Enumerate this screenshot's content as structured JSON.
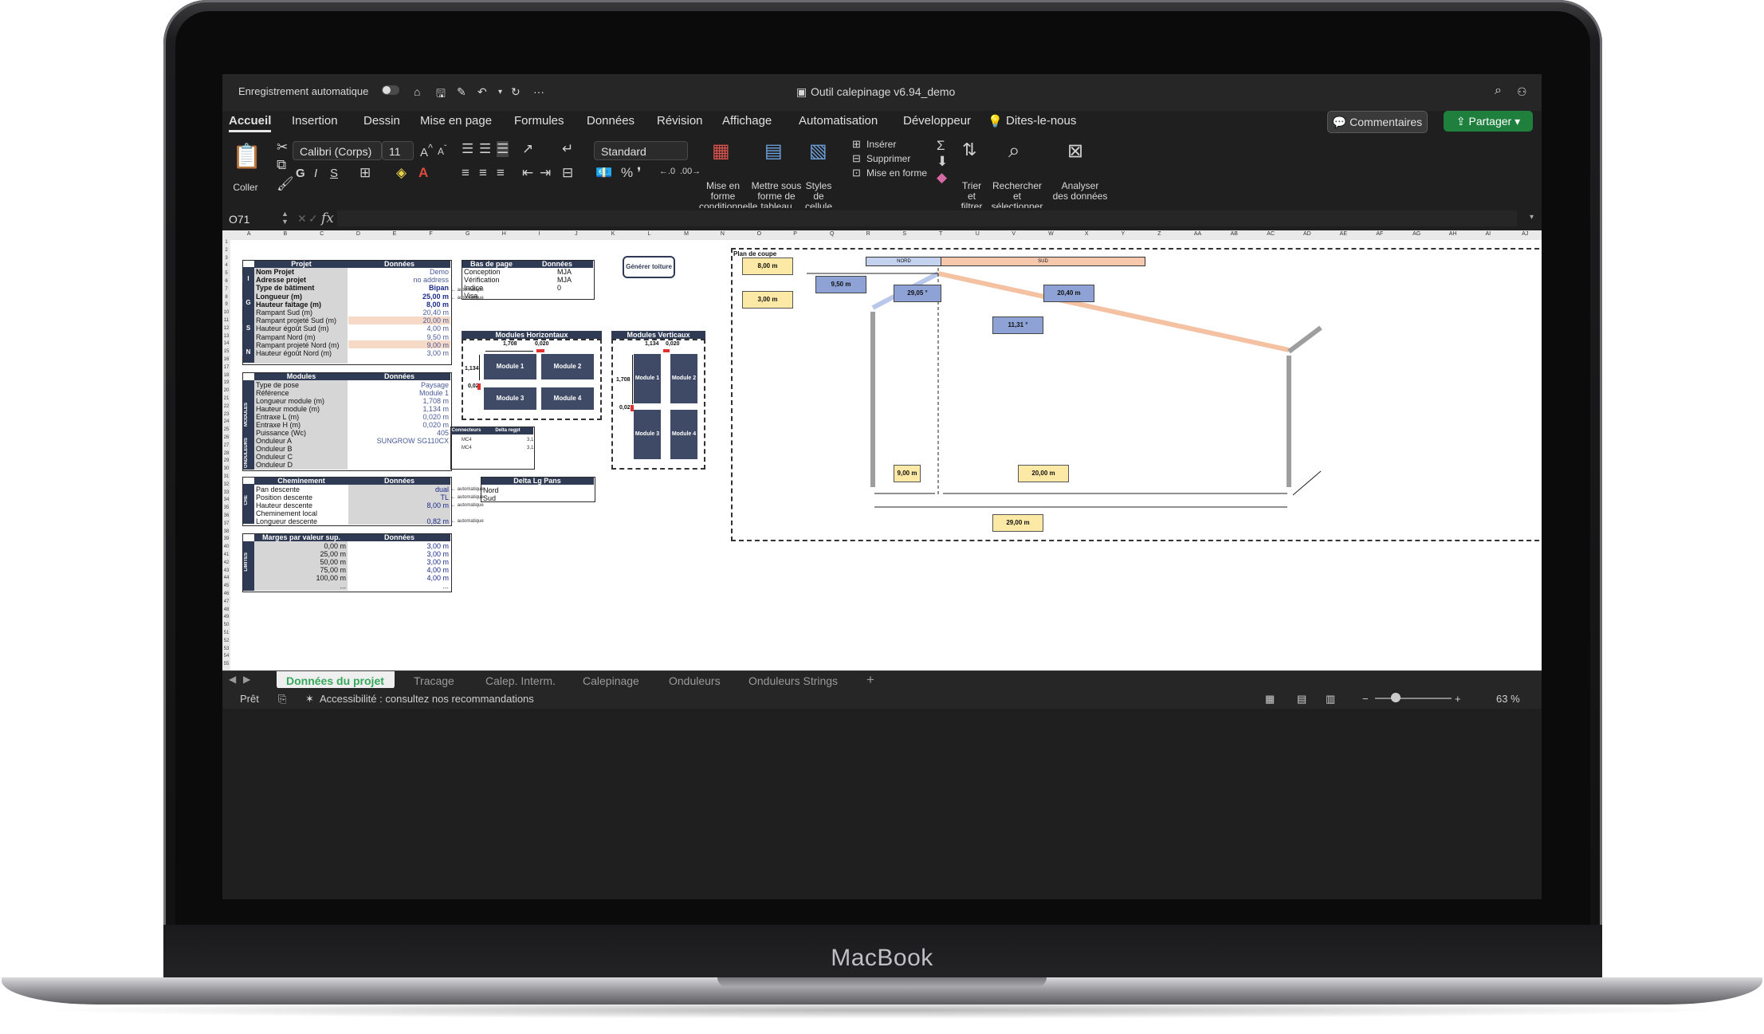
{
  "device": {
    "brand": "MacBook"
  },
  "titlebar": {
    "autosave": "Enregistrement automatique",
    "filename": "Outil calepinage v6.94_demo"
  },
  "menu": {
    "tabs": [
      "Accueil",
      "Insertion",
      "Dessin",
      "Mise en page",
      "Formules",
      "Données",
      "Révision",
      "Affichage",
      "Automatisation",
      "Développeur"
    ],
    "tellme": "Dites-le-nous",
    "comments": "Commentaires",
    "share": "Partager"
  },
  "ribbon": {
    "paste": "Coller",
    "font": "Calibri (Corps)",
    "size": "11",
    "format": "Standard",
    "cond_format_1": "Mise en forme",
    "cond_format_2": "conditionnelle",
    "table_1": "Mettre sous",
    "table_2": "forme de tableau",
    "styles_1": "Styles de",
    "styles_2": "cellule",
    "insert": "Insérer",
    "delete": "Supprimer",
    "format_cells": "Mise en forme",
    "sort_1": "Trier et",
    "sort_2": "filtrer",
    "find_1": "Rechercher et",
    "find_2": "sélectionner",
    "analyze_1": "Analyser",
    "analyze_2": "des données"
  },
  "formula_bar": {
    "cell": "O71",
    "fx": "fx"
  },
  "columns": [
    "A",
    "B",
    "C",
    "D",
    "E",
    "F",
    "G",
    "H",
    "I",
    "J",
    "K",
    "L",
    "M",
    "N",
    "O",
    "P",
    "Q",
    "R",
    "S",
    "T",
    "U",
    "V",
    "W",
    "X",
    "Y",
    "Z",
    "AA",
    "AB",
    "AC",
    "AD",
    "AE",
    "AF",
    "AG",
    "AH",
    "AI",
    "AJ"
  ],
  "projet": {
    "header": [
      "Projet",
      "Données"
    ],
    "rows": [
      {
        "label": "Nom Projet",
        "value": "Demo"
      },
      {
        "label": "Adresse projet",
        "value": "no address"
      },
      {
        "label": "Type de bâtiment",
        "value": "Bipan"
      },
      {
        "label": "Longueur (m)",
        "value": "25,00 m"
      },
      {
        "label": "Hauteur faîtage (m)",
        "value": "8,00 m"
      },
      {
        "label": "Rampant Sud (m)",
        "value": "20,40 m"
      },
      {
        "label": "Rampant projeté Sud (m)",
        "value": "20,00 m"
      },
      {
        "label": "Hauteur égoût Sud (m)",
        "value": "4,00 m"
      },
      {
        "label": "Rampant Nord (m)",
        "value": "9,50 m"
      },
      {
        "label": "Rampant projeté Nord (m)",
        "value": "9,00 m"
      },
      {
        "label": "Hauteur égoût Nord (m)",
        "value": "3,00 m"
      }
    ],
    "side": [
      "I",
      "G",
      "S",
      "N"
    ]
  },
  "modules": {
    "header": [
      "Modules",
      "Données"
    ],
    "rows": [
      {
        "label": "Type de pose",
        "value": "Paysage"
      },
      {
        "label": "Référence",
        "value": "Module 1"
      },
      {
        "label": "Longueur module (m)",
        "value": "1,708 m"
      },
      {
        "label": "Hauteur module (m)",
        "value": "1,134 m"
      },
      {
        "label": "Entraxe L (m)",
        "value": "0,020 m"
      },
      {
        "label": "Entraxe H (m)",
        "value": "0,020 m"
      },
      {
        "label": "Puissance (Wc)",
        "value": "405"
      },
      {
        "label": "Onduleur A",
        "value": "SUNGROW SG110CX"
      },
      {
        "label": "Onduleur B",
        "value": ""
      },
      {
        "label": "Onduleur C",
        "value": ""
      },
      {
        "label": "Onduleur D",
        "value": ""
      }
    ],
    "side": [
      "MODULES",
      "ONDULEURS"
    ]
  },
  "cheminement": {
    "header": [
      "Cheminement",
      "Données"
    ],
    "rows": [
      {
        "label": "Pan descente",
        "value": "dual"
      },
      {
        "label": "Position descente",
        "value": "TL"
      },
      {
        "label": "Hauteur descente",
        "value": "8,00 m"
      },
      {
        "label": "Cheminement local",
        "value": ""
      },
      {
        "label": "Longueur descente",
        "value": "0,82 m"
      }
    ],
    "side": "CHE",
    "auto": "← automatique"
  },
  "marges": {
    "header": [
      "Marges par valeur sup.",
      "Données"
    ],
    "rows": [
      {
        "label": "0,00 m",
        "value": "3,00 m"
      },
      {
        "label": "25,00 m",
        "value": "3,00 m"
      },
      {
        "label": "50,00 m",
        "value": "3,00 m"
      },
      {
        "label": "75,00 m",
        "value": "4,00 m"
      },
      {
        "label": "100,00 m",
        "value": "4,00 m"
      },
      {
        "label": "...",
        "value": "..."
      }
    ],
    "side": "LIMITES"
  },
  "basdepage": {
    "header": [
      "Bas de page",
      "Données"
    ],
    "rows": [
      {
        "label": "Conception",
        "value": "MJA"
      },
      {
        "label": "Vérification",
        "value": "MJA"
      },
      {
        "label": "Indice",
        "value": "0"
      },
      {
        "label": "Visa",
        "value": ""
      }
    ]
  },
  "connecteurs": {
    "header": [
      "Connecteurs",
      "Delta regpt"
    ],
    "rows": [
      {
        "c": "MC4",
        "d": "3,1"
      },
      {
        "c": "MC4",
        "d": "3,1"
      }
    ]
  },
  "delta": {
    "header": "Delta Lg Pans",
    "rows": [
      "Nord",
      "Sud"
    ]
  },
  "generer": "Générer toiture",
  "mod_horiz": {
    "title": "Modules Horizontaux",
    "dims": [
      "1,708",
      "0,020",
      "1,134",
      "0,02"
    ],
    "modules": [
      "Module 1",
      "Module 2",
      "Module 3",
      "Module 4"
    ]
  },
  "mod_vert": {
    "title": "Modules Verticaux",
    "dims": [
      "1,134",
      "0,020",
      "1,708",
      "0,02"
    ],
    "modules": [
      "Module 1",
      "Module 2",
      "Module 3",
      "Module 4"
    ]
  },
  "coupe": {
    "title": "Plan de coupe",
    "nord": "NORD",
    "sud": "SUD",
    "labels": {
      "h_faitage": "8,00 m",
      "h_nord": "3,00 m",
      "rampant_nord": "9,50 m",
      "angle_nord": "29,05 °",
      "rampant_sud": "20,40 m",
      "angle_sud": "11,31 °",
      "proj_nord": "9,00 m",
      "proj_sud": "20,00 m",
      "total": "29,00 m"
    }
  },
  "sheet_tabs": [
    "Données du projet",
    "Tracage",
    "Calep. Interm.",
    "Calepinage",
    "Onduleurs",
    "Onduleurs Strings"
  ],
  "status": {
    "ready": "Prêt",
    "accessibility": "Accessibilité : consultez nos recommandations",
    "zoom": "63 %"
  }
}
